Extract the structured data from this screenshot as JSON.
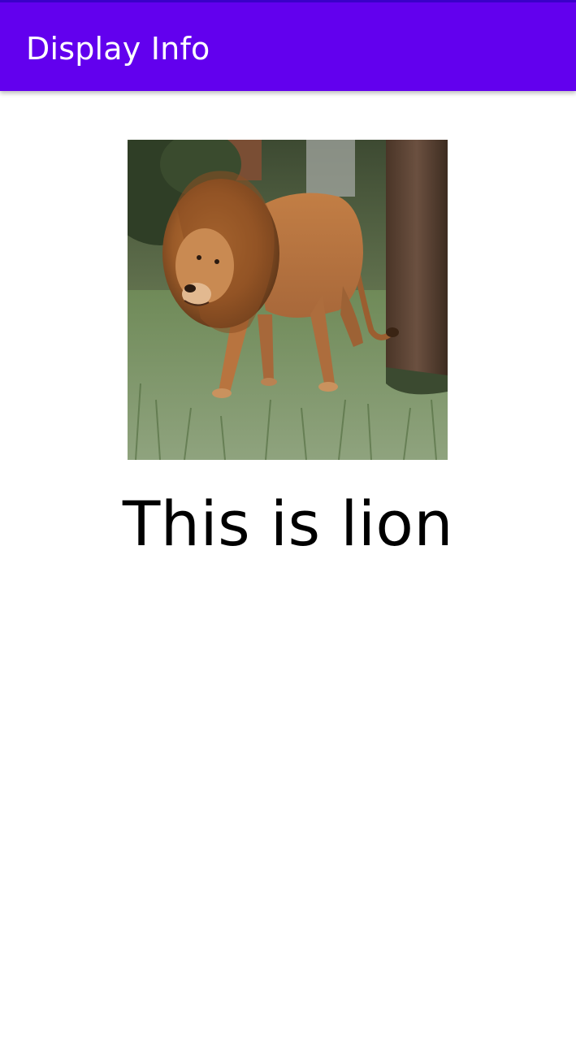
{
  "app_bar": {
    "title": "Display Info",
    "background_color": "#6200EE",
    "title_color": "#FFFFFF"
  },
  "main": {
    "image": {
      "icon": "lion-photo",
      "subject": "lion"
    },
    "caption": "This is lion"
  }
}
